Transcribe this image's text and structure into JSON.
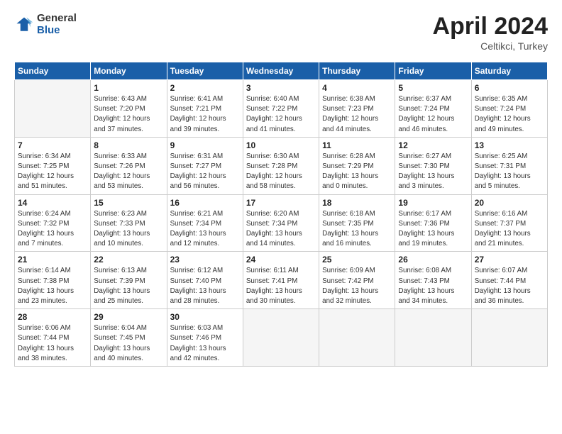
{
  "header": {
    "logo_general": "General",
    "logo_blue": "Blue",
    "title": "April 2024",
    "subtitle": "Celtikci, Turkey"
  },
  "days_of_week": [
    "Sunday",
    "Monday",
    "Tuesday",
    "Wednesday",
    "Thursday",
    "Friday",
    "Saturday"
  ],
  "weeks": [
    [
      {
        "day": "",
        "info": ""
      },
      {
        "day": "1",
        "info": "Sunrise: 6:43 AM\nSunset: 7:20 PM\nDaylight: 12 hours\nand 37 minutes."
      },
      {
        "day": "2",
        "info": "Sunrise: 6:41 AM\nSunset: 7:21 PM\nDaylight: 12 hours\nand 39 minutes."
      },
      {
        "day": "3",
        "info": "Sunrise: 6:40 AM\nSunset: 7:22 PM\nDaylight: 12 hours\nand 41 minutes."
      },
      {
        "day": "4",
        "info": "Sunrise: 6:38 AM\nSunset: 7:23 PM\nDaylight: 12 hours\nand 44 minutes."
      },
      {
        "day": "5",
        "info": "Sunrise: 6:37 AM\nSunset: 7:24 PM\nDaylight: 12 hours\nand 46 minutes."
      },
      {
        "day": "6",
        "info": "Sunrise: 6:35 AM\nSunset: 7:24 PM\nDaylight: 12 hours\nand 49 minutes."
      }
    ],
    [
      {
        "day": "7",
        "info": "Sunrise: 6:34 AM\nSunset: 7:25 PM\nDaylight: 12 hours\nand 51 minutes."
      },
      {
        "day": "8",
        "info": "Sunrise: 6:33 AM\nSunset: 7:26 PM\nDaylight: 12 hours\nand 53 minutes."
      },
      {
        "day": "9",
        "info": "Sunrise: 6:31 AM\nSunset: 7:27 PM\nDaylight: 12 hours\nand 56 minutes."
      },
      {
        "day": "10",
        "info": "Sunrise: 6:30 AM\nSunset: 7:28 PM\nDaylight: 12 hours\nand 58 minutes."
      },
      {
        "day": "11",
        "info": "Sunrise: 6:28 AM\nSunset: 7:29 PM\nDaylight: 13 hours\nand 0 minutes."
      },
      {
        "day": "12",
        "info": "Sunrise: 6:27 AM\nSunset: 7:30 PM\nDaylight: 13 hours\nand 3 minutes."
      },
      {
        "day": "13",
        "info": "Sunrise: 6:25 AM\nSunset: 7:31 PM\nDaylight: 13 hours\nand 5 minutes."
      }
    ],
    [
      {
        "day": "14",
        "info": "Sunrise: 6:24 AM\nSunset: 7:32 PM\nDaylight: 13 hours\nand 7 minutes."
      },
      {
        "day": "15",
        "info": "Sunrise: 6:23 AM\nSunset: 7:33 PM\nDaylight: 13 hours\nand 10 minutes."
      },
      {
        "day": "16",
        "info": "Sunrise: 6:21 AM\nSunset: 7:34 PM\nDaylight: 13 hours\nand 12 minutes."
      },
      {
        "day": "17",
        "info": "Sunrise: 6:20 AM\nSunset: 7:34 PM\nDaylight: 13 hours\nand 14 minutes."
      },
      {
        "day": "18",
        "info": "Sunrise: 6:18 AM\nSunset: 7:35 PM\nDaylight: 13 hours\nand 16 minutes."
      },
      {
        "day": "19",
        "info": "Sunrise: 6:17 AM\nSunset: 7:36 PM\nDaylight: 13 hours\nand 19 minutes."
      },
      {
        "day": "20",
        "info": "Sunrise: 6:16 AM\nSunset: 7:37 PM\nDaylight: 13 hours\nand 21 minutes."
      }
    ],
    [
      {
        "day": "21",
        "info": "Sunrise: 6:14 AM\nSunset: 7:38 PM\nDaylight: 13 hours\nand 23 minutes."
      },
      {
        "day": "22",
        "info": "Sunrise: 6:13 AM\nSunset: 7:39 PM\nDaylight: 13 hours\nand 25 minutes."
      },
      {
        "day": "23",
        "info": "Sunrise: 6:12 AM\nSunset: 7:40 PM\nDaylight: 13 hours\nand 28 minutes."
      },
      {
        "day": "24",
        "info": "Sunrise: 6:11 AM\nSunset: 7:41 PM\nDaylight: 13 hours\nand 30 minutes."
      },
      {
        "day": "25",
        "info": "Sunrise: 6:09 AM\nSunset: 7:42 PM\nDaylight: 13 hours\nand 32 minutes."
      },
      {
        "day": "26",
        "info": "Sunrise: 6:08 AM\nSunset: 7:43 PM\nDaylight: 13 hours\nand 34 minutes."
      },
      {
        "day": "27",
        "info": "Sunrise: 6:07 AM\nSunset: 7:44 PM\nDaylight: 13 hours\nand 36 minutes."
      }
    ],
    [
      {
        "day": "28",
        "info": "Sunrise: 6:06 AM\nSunset: 7:44 PM\nDaylight: 13 hours\nand 38 minutes."
      },
      {
        "day": "29",
        "info": "Sunrise: 6:04 AM\nSunset: 7:45 PM\nDaylight: 13 hours\nand 40 minutes."
      },
      {
        "day": "30",
        "info": "Sunrise: 6:03 AM\nSunset: 7:46 PM\nDaylight: 13 hours\nand 42 minutes."
      },
      {
        "day": "",
        "info": ""
      },
      {
        "day": "",
        "info": ""
      },
      {
        "day": "",
        "info": ""
      },
      {
        "day": "",
        "info": ""
      }
    ]
  ]
}
